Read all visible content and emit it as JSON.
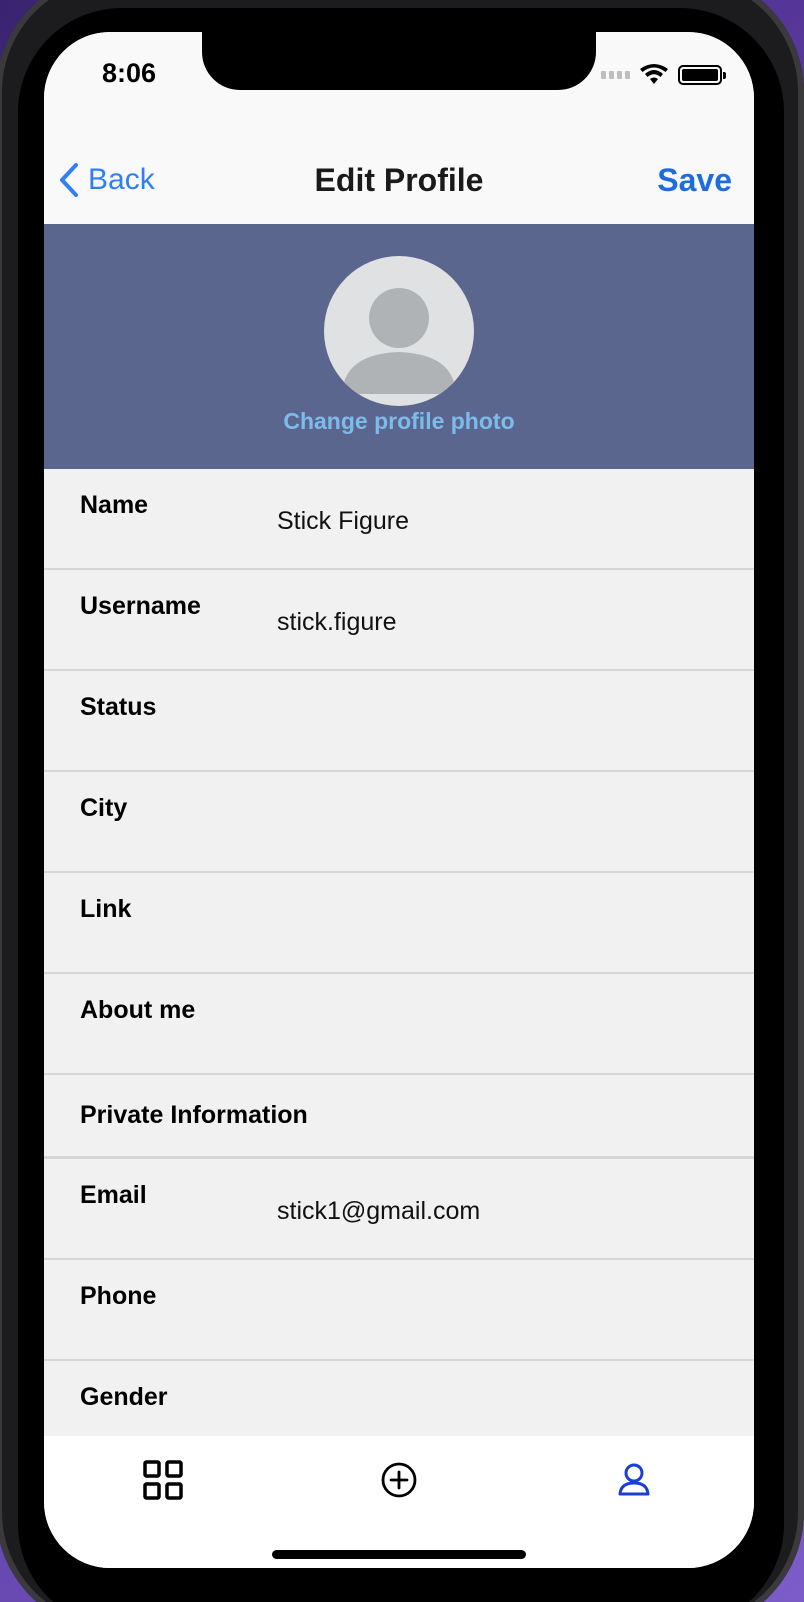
{
  "status_bar": {
    "time": "8:06"
  },
  "nav": {
    "back_label": "Back",
    "title": "Edit Profile",
    "save_label": "Save"
  },
  "profile": {
    "change_photo_label": "Change profile photo"
  },
  "fields": [
    {
      "label": "Name",
      "value": "Stick Figure"
    },
    {
      "label": "Username",
      "value": "stick.figure"
    },
    {
      "label": "Status",
      "value": ""
    },
    {
      "label": "City",
      "value": ""
    },
    {
      "label": "Link",
      "value": ""
    },
    {
      "label": "About me",
      "value": ""
    }
  ],
  "private_section": {
    "title": "Private Information"
  },
  "private_fields": [
    {
      "label": "Email",
      "value": "stick1@gmail.com"
    },
    {
      "label": "Phone",
      "value": ""
    },
    {
      "label": "Gender",
      "value": ""
    }
  ],
  "tabs": [
    {
      "icon": "grid-icon",
      "active": false
    },
    {
      "icon": "plus-circle-icon",
      "active": false
    },
    {
      "icon": "person-icon",
      "active": true
    }
  ],
  "colors": {
    "accent": "#2f7ff5",
    "header_bg": "#5b668f",
    "link": "#7dbbea",
    "active_tab": "#1a3fd4"
  }
}
